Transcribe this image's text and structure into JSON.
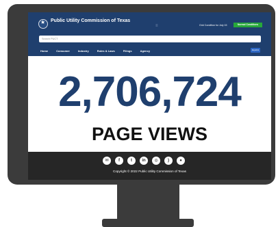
{
  "header": {
    "title": "Public Utility Commission of Texas",
    "menu_icon": "≡",
    "grid_condition_text": "Grid Condition for July 15",
    "grid_status": "Normal Conditions",
    "grid_status_color": "#27a83a"
  },
  "search": {
    "placeholder": "Search PUCT"
  },
  "nav": {
    "items": [
      "Home",
      "Consumer",
      "Industry",
      "Rules & Laws",
      "Filings",
      "Agency"
    ],
    "language_button": "Español"
  },
  "stats": {
    "value": "2,706,724",
    "label": "PAGE VIEWS"
  },
  "footer": {
    "social_icons": [
      "email-icon",
      "facebook-icon",
      "twitter-icon",
      "linkedin-icon",
      "instagram-icon",
      "rss-icon",
      "location-icon"
    ],
    "copyright": "Copyright © 2022 Public Utility Commission of Texas"
  },
  "colors": {
    "brand_navy": "#1f3f6e",
    "monitor_gray": "#3b3b3b",
    "footer_dark": "#262626"
  }
}
